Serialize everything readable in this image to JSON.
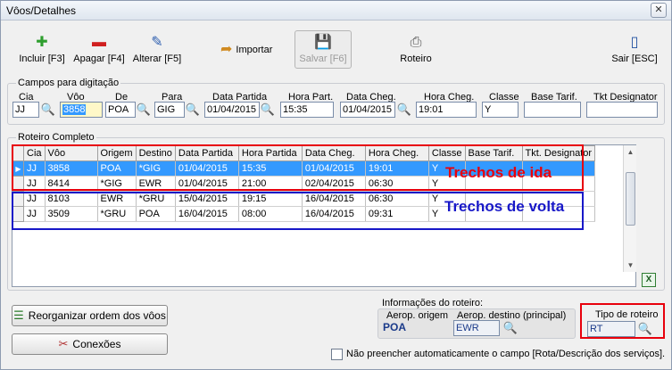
{
  "window": {
    "title": "Vôos/Detalhes",
    "close": "✕"
  },
  "toolbar": {
    "incluir": "Incluir [F3]",
    "apagar": "Apagar [F4]",
    "alterar": "Alterar [F5]",
    "importar": "Importar",
    "salvar": "Salvar [F6]",
    "roteiro": "Roteiro",
    "sair": "Sair [ESC]"
  },
  "campos": {
    "title": "Campos para digitação",
    "labels": {
      "cia": "Cia",
      "voo": "Vôo",
      "de": "De",
      "para": "Para",
      "data_partida": "Data Partida",
      "hora_part": "Hora Part.",
      "data_cheg": "Data Cheg.",
      "hora_cheg": "Hora Cheg.",
      "classe": "Classe",
      "base_tarif": "Base Tarif.",
      "tkt_designator": "Tkt Designator"
    },
    "values": {
      "cia": "JJ",
      "voo": "3858",
      "de": "POA",
      "para": "GIG",
      "data_partida": "01/04/2015",
      "hora_part": "15:35",
      "data_cheg": "01/04/2015",
      "hora_cheg": "19:01",
      "classe": "Y",
      "base_tarif": "",
      "tkt_designator": ""
    }
  },
  "roteiro": {
    "title": "Roteiro Completo",
    "columns": [
      "Cia",
      "Vôo",
      "Origem",
      "Destino",
      "Data Partida",
      "Hora Partida",
      "Data Cheg.",
      "Hora Cheg.",
      "Classe",
      "Base Tarif.",
      "Tkt. Designator"
    ],
    "rows": [
      [
        "JJ",
        "3858",
        "POA",
        "*GIG",
        "01/04/2015",
        "15:35",
        "01/04/2015",
        "19:01",
        "Y",
        "",
        ""
      ],
      [
        "JJ",
        "8414",
        "*GIG",
        "EWR",
        "01/04/2015",
        "21:00",
        "02/04/2015",
        "06:30",
        "Y",
        "",
        ""
      ],
      [
        "JJ",
        "8103",
        "EWR",
        "*GRU",
        "15/04/2015",
        "19:15",
        "16/04/2015",
        "06:30",
        "Y",
        "",
        ""
      ],
      [
        "JJ",
        "3509",
        "*GRU",
        "POA",
        "16/04/2015",
        "08:00",
        "16/04/2015",
        "09:31",
        "Y",
        "",
        ""
      ]
    ],
    "annotations": {
      "ida": "Trechos de ida",
      "volta": "Trechos de volta"
    }
  },
  "buttons": {
    "reorganizar": "Reorganizar ordem dos vôos",
    "conexoes": "Conexões"
  },
  "info": {
    "title": "Informações do roteiro:",
    "aerop_origem_label": "Aerop. origem",
    "aerop_origem": "POA",
    "aerop_destino_label": "Aerop. destino (principal)",
    "aerop_destino": "EWR",
    "tipo_roteiro_label": "Tipo de roteiro",
    "tipo_roteiro": "RT"
  },
  "checkbox": {
    "label": "Não preencher automaticamente o campo [Rota/Descrição dos serviços].",
    "checked": false
  },
  "colors": {
    "accent": "#3399ff",
    "annot_red": "#e8000c",
    "annot_blue": "#1818c8"
  }
}
